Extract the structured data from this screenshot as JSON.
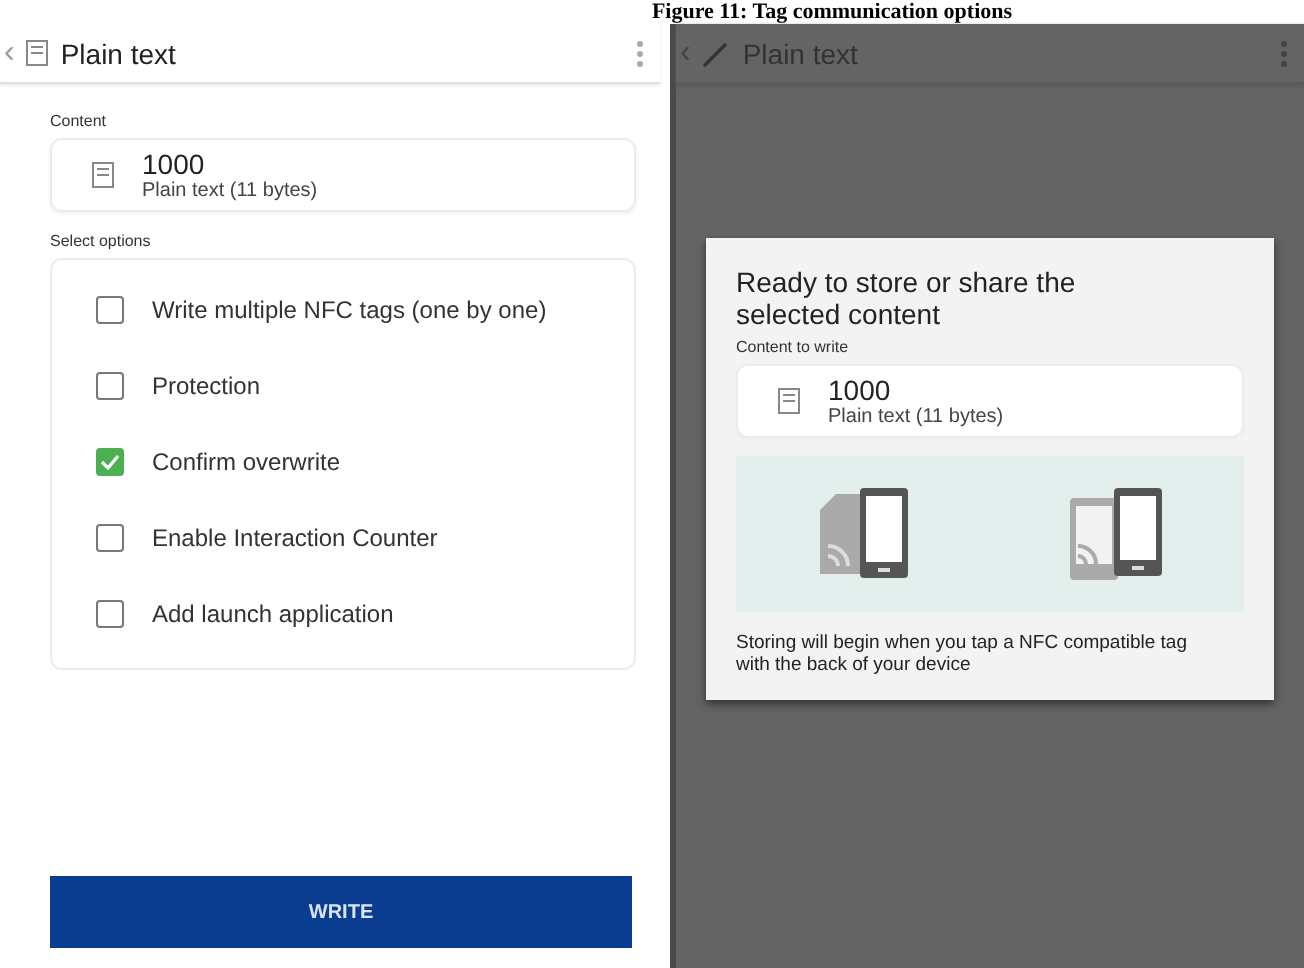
{
  "caption": "Figure 11: Tag communication options",
  "left_screen": {
    "header": {
      "back": "‹",
      "title": "Plain text"
    },
    "content_label": "Content",
    "content": {
      "value": "1000",
      "type": "Plain text (11 bytes)"
    },
    "options_label": "Select options",
    "options": [
      {
        "label": "Write multiple NFC tags (one by one)",
        "checked": false
      },
      {
        "label": "Protection",
        "checked": false
      },
      {
        "label": "Confirm overwrite",
        "checked": true
      },
      {
        "label": "Enable Interaction Counter",
        "checked": false
      },
      {
        "label": "Add launch application",
        "checked": false
      }
    ],
    "button": "WRITE"
  },
  "right_screen": {
    "header": {
      "back": "‹",
      "title": "Plain text"
    },
    "dialog": {
      "title": "Ready to store or share the selected content",
      "content_label": "Content to write",
      "content": {
        "value": "1000",
        "type": "Plain text (11 bytes)"
      },
      "message": "Storing will begin when you tap a NFC compatible tag with the back of your device"
    }
  }
}
